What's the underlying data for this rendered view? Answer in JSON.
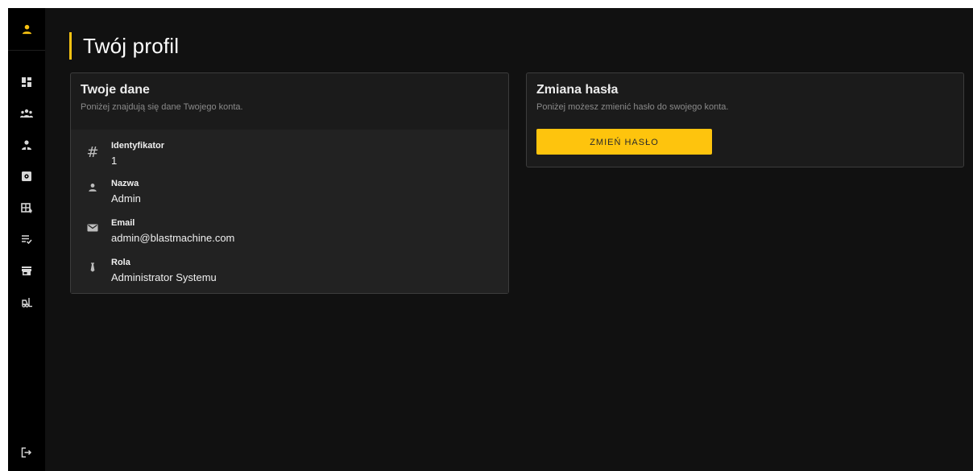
{
  "header": {
    "title": "Twój profil"
  },
  "sidebar": {
    "items": [
      {
        "icon": "dashboard-icon"
      },
      {
        "icon": "users-group-icon"
      },
      {
        "icon": "employee-icon"
      },
      {
        "icon": "settings-box-icon"
      },
      {
        "icon": "table-add-icon"
      },
      {
        "icon": "checklist-icon"
      },
      {
        "icon": "store-icon"
      },
      {
        "icon": "forklift-icon"
      }
    ],
    "bottom_icon": "logout-icon"
  },
  "profile_card": {
    "title": "Twoje dane",
    "subtitle": "Poniżej znajdują się dane Twojego konta.",
    "fields": [
      {
        "icon": "hash-icon",
        "label": "Identyfikator",
        "value": "1"
      },
      {
        "icon": "person-icon",
        "label": "Nazwa",
        "value": "Admin"
      },
      {
        "icon": "email-icon",
        "label": "Email",
        "value": "admin@blastmachine.com"
      },
      {
        "icon": "tie-icon",
        "label": "Rola",
        "value": "Administrator Systemu"
      }
    ]
  },
  "password_card": {
    "title": "Zmiana hasła",
    "subtitle": "Poniżej możesz zmienić hasło do swojego konta.",
    "button_label": "ZMIEŃ HASŁO"
  },
  "colors": {
    "accent": "#f7c212",
    "background": "#111111",
    "sidebar": "#000000",
    "card": "#1b1b1b"
  }
}
